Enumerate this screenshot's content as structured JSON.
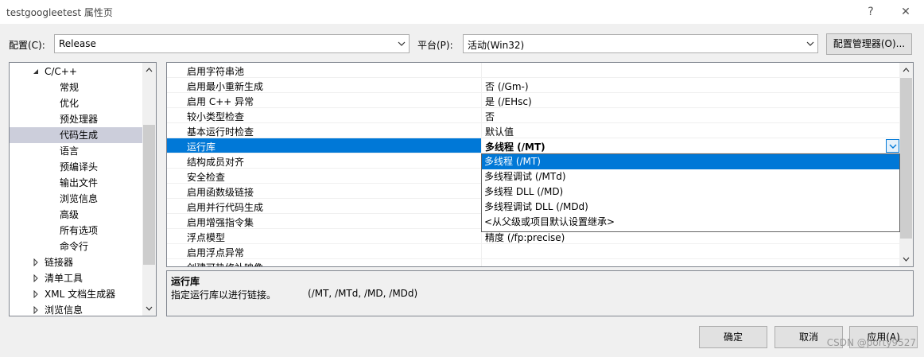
{
  "window": {
    "title": "testgoogleetest 属性页",
    "help_label": "?",
    "close_label": "✕"
  },
  "config": {
    "config_label": "配置(C):",
    "config_value": "Release",
    "platform_label": "平台(P):",
    "platform_value": "活动(Win32)",
    "manager_label": "配置管理器(O)..."
  },
  "tree": {
    "items": [
      {
        "label": "C/C++",
        "arrow": "expanded"
      },
      {
        "label": "常规"
      },
      {
        "label": "优化"
      },
      {
        "label": "预处理器"
      },
      {
        "label": "代码生成",
        "selected": true
      },
      {
        "label": "语言"
      },
      {
        "label": "预编译头"
      },
      {
        "label": "输出文件"
      },
      {
        "label": "浏览信息"
      },
      {
        "label": "高级"
      },
      {
        "label": "所有选项"
      },
      {
        "label": "命令行"
      },
      {
        "label": "链接器",
        "arrow": "collapsed"
      },
      {
        "label": "清单工具",
        "arrow": "collapsed"
      },
      {
        "label": "XML 文档生成器",
        "arrow": "collapsed"
      },
      {
        "label": "浏览信息",
        "arrow": "collapsed"
      }
    ]
  },
  "grid": {
    "rows": [
      {
        "name": "启用字符串池",
        "value": ""
      },
      {
        "name": "启用最小重新生成",
        "value": "否 (/Gm-)"
      },
      {
        "name": "启用 C++ 异常",
        "value": "是 (/EHsc)"
      },
      {
        "name": "较小类型检查",
        "value": "否"
      },
      {
        "name": "基本运行时检查",
        "value": "默认值"
      },
      {
        "name": "运行库",
        "value": "多线程 (/MT)",
        "selected": true
      },
      {
        "name": "结构成员对齐",
        "value": ""
      },
      {
        "name": "安全检查",
        "value": ""
      },
      {
        "name": "启用函数级链接",
        "value": ""
      },
      {
        "name": "启用并行代码生成",
        "value": ""
      },
      {
        "name": "启用增强指令集",
        "value": ""
      },
      {
        "name": "浮点模型",
        "value": "精度 (/fp:precise)"
      },
      {
        "name": "启用浮点异常",
        "value": ""
      },
      {
        "name": "创建可热修补映像",
        "value": ""
      }
    ]
  },
  "dropdown": {
    "options": [
      {
        "label": "多线程 (/MT)",
        "selected": true
      },
      {
        "label": "多线程调试 (/MTd)"
      },
      {
        "label": "多线程 DLL (/MD)"
      },
      {
        "label": "多线程调试 DLL (/MDd)"
      },
      {
        "label": "<从父级或项目默认设置继承>"
      }
    ]
  },
  "description": {
    "title": "运行库",
    "text": "指定运行库以进行链接。",
    "flags": "(/MT, /MTd, /MD, /MDd)"
  },
  "buttons": {
    "ok": "确定",
    "cancel": "取消",
    "apply": "应用(A)"
  },
  "watermark": "CSDN @porty9527",
  "colors": {
    "selection": "#0078d7",
    "tree_selection": "#cccedb",
    "dialog_bg": "#f0f0f0"
  }
}
